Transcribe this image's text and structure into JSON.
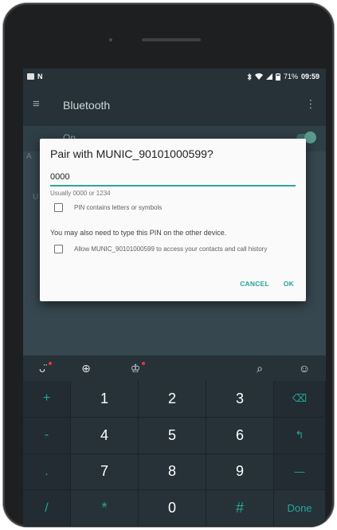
{
  "status_bar": {
    "left_icons": [
      "image-notification-icon",
      "n-notification-icon"
    ],
    "n_glyph": "N",
    "right_icons": [
      "bluetooth-icon",
      "wifi-icon",
      "signal-icon",
      "battery-icon"
    ],
    "battery": "71%",
    "time": "09:59"
  },
  "toolbar": {
    "title": "Bluetooth",
    "menu_glyph": "≡",
    "overflow_glyph": "⋮"
  },
  "settings": {
    "on_label": "On",
    "switch_on": true,
    "bg_letter_a": "A",
    "bg_letter_u": "U"
  },
  "dialog": {
    "title": "Pair with MUNIC_90101000599?",
    "pin_value": "0000",
    "hint": "Usually 0000 or 1234",
    "checkbox_letters_label": "PIN contains letters or symbols",
    "info": "You may also need to type this PIN on the other device.",
    "checkbox_access_label": "Allow MUNIC_90101000599 to access your contacts and call history",
    "cancel": "CANCEL",
    "ok": "OK"
  },
  "keyboard": {
    "toolbar": [
      {
        "name": "sticker-icon",
        "glyph": "ᴗ̈",
        "dot": true
      },
      {
        "name": "globe-icon",
        "glyph": "⊕",
        "dot": false
      },
      {
        "name": "theme-shirt-icon",
        "glyph": "♔",
        "dot": true
      },
      {
        "name": "spacer",
        "glyph": "",
        "dot": false
      },
      {
        "name": "search-icon",
        "glyph": "⌕",
        "dot": false
      },
      {
        "name": "emoji-icon",
        "glyph": "☺",
        "dot": false
      }
    ],
    "rows": [
      [
        "+",
        "1",
        "2",
        "3",
        "⌫"
      ],
      [
        "-",
        "4",
        "5",
        "6",
        "↰"
      ],
      [
        ".",
        "7",
        "8",
        "9",
        "—"
      ],
      [
        "/",
        "*",
        "0",
        "#",
        "Done"
      ]
    ]
  },
  "colors": {
    "accent": "#26a69a",
    "dialog_bg": "#fafafa",
    "appbar": "#263238",
    "keyboard_key": "#263238"
  }
}
